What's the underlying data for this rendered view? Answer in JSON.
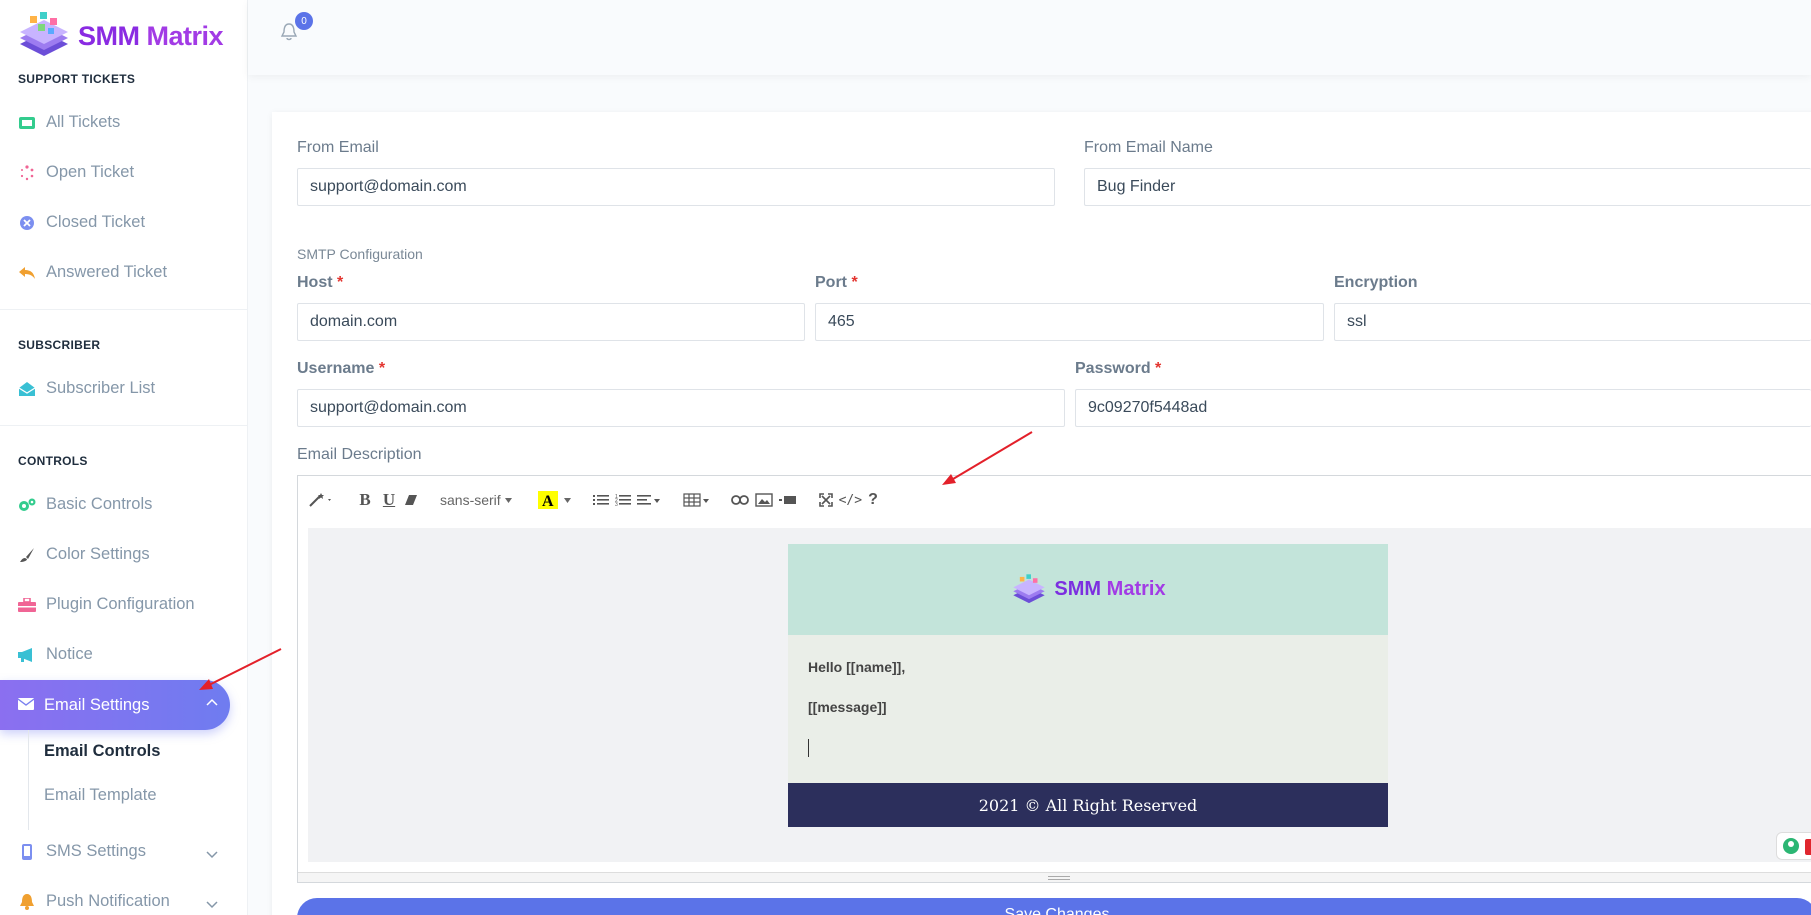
{
  "brand": {
    "name_part1": "SMM",
    "name_part2": "Matrix",
    "brand_color": "#8a2be2"
  },
  "notifications": {
    "count": "0"
  },
  "sidebar": {
    "sections": {
      "support": "SUPPORT TICKETS",
      "subscriber": "SUBSCRIBER",
      "controls": "CONTROLS"
    },
    "items": [
      {
        "label": "All Tickets",
        "icon": "ticket-icon"
      },
      {
        "label": "Open Ticket",
        "icon": "spinner-icon"
      },
      {
        "label": "Closed Ticket",
        "icon": "times-circle-icon"
      },
      {
        "label": "Answered Ticket",
        "icon": "reply-icon"
      },
      {
        "label": "Subscriber List",
        "icon": "envelope-open-icon"
      },
      {
        "label": "Basic Controls",
        "icon": "gears-icon"
      },
      {
        "label": "Color Settings",
        "icon": "paint-brush-icon"
      },
      {
        "label": "Plugin Configuration",
        "icon": "toolbox-icon"
      },
      {
        "label": "Notice",
        "icon": "megaphone-icon"
      },
      {
        "label": "Email Settings",
        "icon": "envelope-icon"
      },
      {
        "label": "SMS Settings",
        "icon": "mobile-icon"
      },
      {
        "label": "Push Notification",
        "icon": "bell-icon"
      }
    ],
    "email_sub": {
      "controls": "Email Controls",
      "template": "Email Template"
    }
  },
  "form": {
    "from_email_label": "From Email",
    "from_email_value": "support@domain.com",
    "from_name_label": "From Email Name",
    "from_name_value": "Bug Finder",
    "smtp_title": "SMTP Configuration",
    "host_label": "Host",
    "host_value": "domain.com",
    "port_label": "Port",
    "port_value": "465",
    "encryption_label": "Encryption",
    "encryption_value": "ssl",
    "username_label": "Username",
    "username_value": "support@domain.com",
    "password_label": "Password",
    "password_value": "9c09270f5448ad",
    "required_mark": "*",
    "description_label": "Email Description",
    "save_label": "Save Changes"
  },
  "editor": {
    "font_name": "sans-serif",
    "email_brand_part1": "SMM",
    "email_brand_part2": "Matrix",
    "greeting": "Hello [[name]],",
    "message": "[[message]]",
    "footer": "2021 © All Right Reserved"
  },
  "colors": {
    "accent": "#5b73e8",
    "email_header_bg": "#c3e4da",
    "email_body_bg": "#eaeee8",
    "email_footer_bg": "#2c2f5c",
    "annotation_arrow": "#e3202a"
  }
}
